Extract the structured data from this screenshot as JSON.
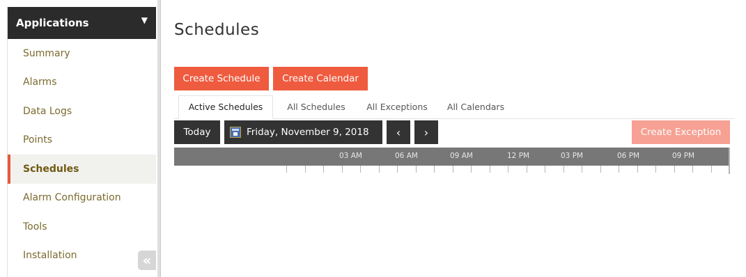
{
  "sidebar": {
    "header": "Applications",
    "caret": "▼",
    "items": [
      {
        "label": "Summary"
      },
      {
        "label": "Alarms"
      },
      {
        "label": "Data Logs"
      },
      {
        "label": "Points"
      },
      {
        "label": "Schedules",
        "active": true
      },
      {
        "label": "Alarm Configuration"
      },
      {
        "label": "Tools"
      },
      {
        "label": "Installation"
      }
    ],
    "collapse_icon": "«"
  },
  "page": {
    "title": "Schedules"
  },
  "actions": {
    "create_schedule": "Create Schedule",
    "create_calendar": "Create Calendar",
    "create_exception": "Create Exception"
  },
  "tabs": [
    {
      "label": "Active Schedules",
      "active": true
    },
    {
      "label": "All Schedules"
    },
    {
      "label": "All Exceptions"
    },
    {
      "label": "All Calendars"
    }
  ],
  "date_nav": {
    "today": "Today",
    "date": "Friday, November 9, 2018",
    "prev": "‹",
    "next": "›"
  },
  "timeline": {
    "labels": [
      "03 AM",
      "06 AM",
      "09 AM",
      "12 PM",
      "03 PM",
      "06 PM",
      "09 PM"
    ]
  },
  "colors": {
    "accent": "#ef5b3f",
    "accent_disabled": "#f6a193",
    "dark": "#333333",
    "timeline": "#777777",
    "sidebar_text": "#7a6a2e"
  }
}
